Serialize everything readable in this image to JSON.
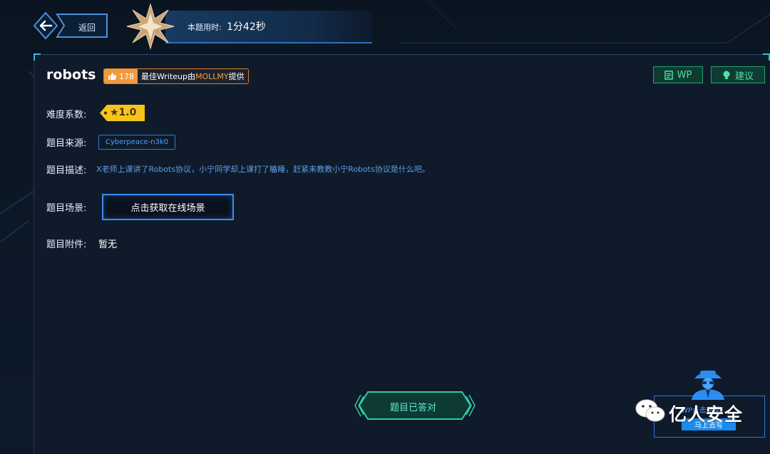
{
  "header": {
    "back_label": "返回",
    "time_label": "本题用时:",
    "time_value": "1分42秒"
  },
  "challenge": {
    "title": "robots",
    "likes": "178",
    "best_writeup_prefix": "最佳Writeup由",
    "best_writeup_user": "MOLLMY",
    "best_writeup_suffix": "提供",
    "wp_label": "WP",
    "suggest_label": "建议",
    "difficulty_label": "难度系数:",
    "difficulty_value": "★1.0",
    "source_label": "题目来源:",
    "source_value": "Cyberpeace-n3k0",
    "desc_label": "题目描述:",
    "desc_value": "X老师上课讲了Robots协议，小宁同学却上课打了瞌睡，赶紧来教教小宁Robots协议是什么吧。",
    "scene_label": "题目场景:",
    "scene_button": "点击获取在线场景",
    "attach_label": "题目附件:",
    "attach_value": "暂无",
    "answered_label": "题目已答对"
  },
  "promo": {
    "text": "WP点击这里",
    "button": "马上去写"
  },
  "watermark": {
    "text": "亿人安全"
  },
  "colors": {
    "background": "#0c1624",
    "accent_blue": "#3c8cf0",
    "accent_green": "#4fe0a4",
    "like_orange": "#f19a3e",
    "difficulty_yellow": "#f6c41b"
  }
}
